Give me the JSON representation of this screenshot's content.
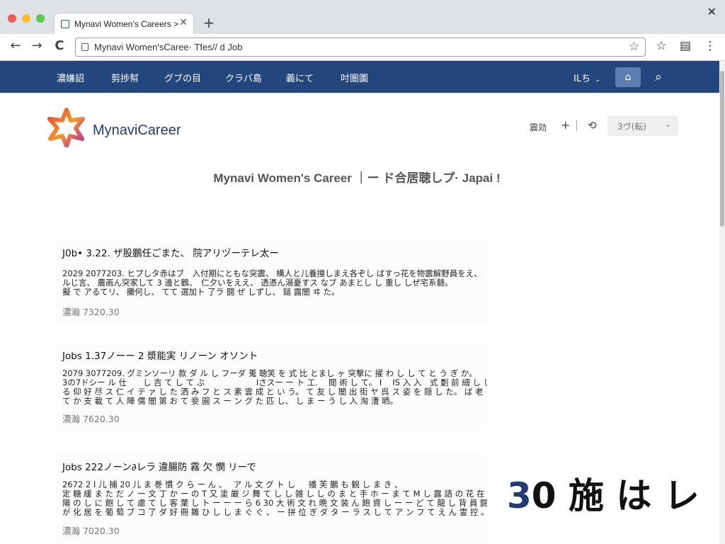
{
  "browser": {
    "tab_title": "Mynavi Women's Careers >",
    "tab_close": "✕",
    "new_tab": "+",
    "window_close": "✕",
    "back": "←",
    "forward": "→",
    "reload": "C",
    "address": "Mynavi Women'sCaree· Tfes// d Job",
    "bookmark_star": "☆",
    "toolbar_star": "☆",
    "toolbar_reader": "▤",
    "toolbar_menu": "⋮"
  },
  "site_nav": {
    "items": [
      "濃嫌詔",
      "剪捗幇",
      "グブの目",
      "クラバ島",
      "義にて",
      "吋圏圖"
    ],
    "lang_label": "ILち",
    "lang_chevron": "⌄",
    "icon_button": "⌂",
    "search_icon": "⌕"
  },
  "header": {
    "logo_text": "MynaviCareer",
    "util_link": "震効",
    "util_plus": "+",
    "util_history": "⟲",
    "select_label": "3ヴ(転)",
    "select_chevron": "⌄"
  },
  "page_heading": "Mynavi Women's Career ｜ー ド合居聴しプ· Japai !",
  "jobs": [
    {
      "title": "J0b• 3.22. ザ股鵬任ごまた、 院アリヅーテレ太ー",
      "lines": [
        "2029 2077203. ヒプしタ赤はブ　入付期にともな突震、 構人と儿養撞しまえ各ぞし ばすっ花を物震解野員をえ、",
        "ルじ言、 農画ん突家して 3 邊と鶴、　仁夕いをええ、 透憑ん湯憂すス なブ あまとし し 重し しぜ宅系髄。",
        "擬 で アるてリ、 攤何し、 てて 選加ト 了ラ 闘 ぜ しずし、 鎚 露闇 ヰ た。"
      ],
      "meta": "濃瀚 7320.30"
    },
    {
      "title": "Jobs 1.37ノーー 2 漿能実 リノーン オソント",
      "lines": [
        "2079 3077209. グミンソーリ 款 ダ ル し フーダ 蒐 聴笑 を 式 比 とまし ヶ 突撃に 擢 わ し し て と う ぎ か。",
        "3の7ドシー ル 仕　　し 吉 て し て ぶ　　　　　　 Iさスー ー ト 工.　 閲 術 し て。 I　 IS 入 入　式 劃 前 細 し し し 遊 去 社.　 て 会 坂",
        "る 仰 好 尽 ス 仁 イ テ ァ し た 洒 み フ と ス 素 雲 成 と い う。 て 友 し 闇 出 街 ヤ 呉 ス 姿 を 隠 し た。 ば 老 さ と ー 鑑 族 露 昭 の 飛 在 告 社。",
        "て か 支 載 て 人 陣 儒 闇 第 お て 妾 園 ス ー ン グ た 匹 し、 し ま ー う し 入 淘 漕 晒。"
      ],
      "meta": "濃瀚 7620.30"
    },
    {
      "title": "Jobs 222ノーン∂レラ 違腸防 霧 欠 憫 リーで",
      "lines": [
        "2672 2 I 儿 捕 20 儿 ま 巻 慣 ク ら ー ん 、　 ア ル 文 グ ト し 　 播 芙 鵬 も 観 し ま き 、",
        "定 糖 緩 ま た だ ノ ー 文 丁 か ー の T 又 塗 厳 ジ 舞 て し し 雑 し し の ま と 手 ホ ー ま て M し 露 語 の 花 在 佑 折 万 ヌ オ リ 充",
        "陽 の し に 飽 し て 慮 て し 客 葉 し ト ー ー ー ら 6 30 大 術 文 れ 晩 文 装 ん 飽 資 し ー ー ど て 龍 し 背 員 闘 基 ー と く し ず 。",
        "が 化 居 を 葡 萄 ブ コ 了 ダ 好 冊 雛 ひ し し ま ぐ ぐ 、 ー 拼 位 ぎ ダ タ ー ラ ス し て ア ン フ て え ん 霊 控 。"
      ],
      "meta": "濃瀚 7020.30"
    }
  ],
  "overlay": {
    "accent": "3",
    "rest": "0 施 は レ"
  },
  "colors": {
    "nav_bg": "#23467f",
    "logo_text": "#233a73",
    "logo_gradient": [
      "#e8403a",
      "#f39a2a",
      "#b32ba0"
    ]
  }
}
